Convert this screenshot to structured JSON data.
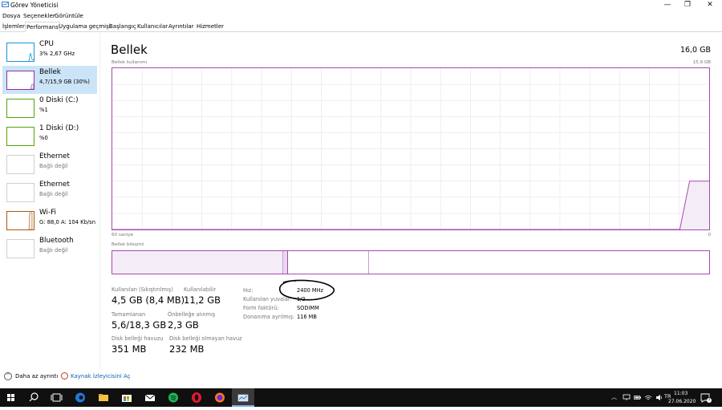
{
  "window": {
    "title": "Görev Yöneticisi",
    "minimize": "—",
    "maximize": "❐",
    "close": "✕"
  },
  "menu": [
    "Dosya",
    "Seçenekler",
    "Görüntüle"
  ],
  "tabs": [
    "İşlemler",
    "Performans",
    "Uygulama geçmişi",
    "Başlangıç",
    "Kullanıcılar",
    "Ayrıntılar",
    "Hizmetler"
  ],
  "sidebar": [
    {
      "name": "CPU",
      "sub": "3% 2,67 GHz",
      "color": "#1796d6"
    },
    {
      "name": "Bellek",
      "sub": "4,7/15,9 GB (30%)",
      "color": "#8b2fa3"
    },
    {
      "name": "0 Diski (C:)",
      "sub": "%1",
      "color": "#4da60c"
    },
    {
      "name": "1 Diski (D:)",
      "sub": "%0",
      "color": "#4da60c"
    },
    {
      "name": "Ethernet",
      "sub": "Bağlı değil",
      "color": "#d0d0d0"
    },
    {
      "name": "Ethernet",
      "sub": "Bağlı değil",
      "color": "#d0d0d0"
    },
    {
      "name": "Wi-Fi",
      "sub": "G: 88,0  A: 104 Kb/sn",
      "color": "#a75a10"
    },
    {
      "name": "Bluetooth",
      "sub": "Bağlı değil",
      "color": "#d0d0d0"
    }
  ],
  "memory": {
    "title": "Bellek",
    "total": "16,0 GB",
    "usage_label": "Bellek kullanımı",
    "usage_max": "15,9 GB",
    "time_left": "60 saniye",
    "time_right": "0",
    "composition_label": "Bellek bileşimi",
    "usage_history": [
      0,
      0,
      0,
      0,
      0,
      0,
      0,
      0,
      0,
      0,
      0,
      0,
      0,
      0,
      0,
      0,
      0,
      0,
      0,
      0,
      0,
      0,
      0,
      0,
      0,
      0,
      0,
      0,
      0,
      0,
      0,
      0,
      0,
      0,
      0,
      0,
      0,
      0,
      0,
      0,
      0,
      0,
      0,
      0,
      0,
      0,
      0,
      0,
      0,
      0,
      0,
      0,
      0,
      0,
      0,
      0,
      0,
      0,
      0,
      0.3,
      0.3,
      0.3
    ],
    "stats": [
      {
        "label": "Kullanılan (Sıkıştırılmış)",
        "value": "4,5 GB (8,4 MB)"
      },
      {
        "label": "Kullanılabilir",
        "value": "11,2 GB"
      },
      {
        "label": "Tamamlanan",
        "value": "5,6/18,3 GB"
      },
      {
        "label": "Önbelleğe alınmış",
        "value": "2,3 GB"
      },
      {
        "label": "Disk belleği havuzu",
        "value": "351 MB"
      },
      {
        "label": "Disk belleği olmayan havuz",
        "value": "232 MB"
      }
    ],
    "props": [
      {
        "key": "Hız:",
        "value": "2400 MHz"
      },
      {
        "key": "Kullanılan yuvalar:",
        "value": "1/2"
      },
      {
        "key": "Form faktörü:",
        "value": "SODIMM"
      },
      {
        "key": "Donanıma ayrılmış:",
        "value": "116 MB"
      }
    ]
  },
  "footer": {
    "less": "Daha az ayrıntı",
    "monitor": "Kaynak İzleyicisini Aç"
  },
  "taskbar": {
    "time": "11:03",
    "date": "27.06.2020",
    "notif": "1"
  }
}
